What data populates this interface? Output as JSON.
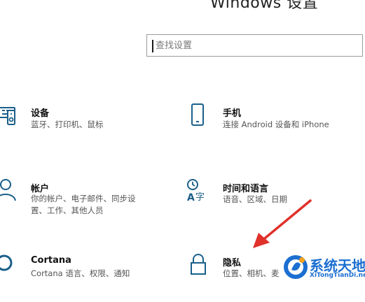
{
  "window": {
    "title": "Windows 设置"
  },
  "search": {
    "placeholder": "查找设置",
    "value": ""
  },
  "tiles": [
    {
      "name": "设备",
      "desc_lines": [
        "蓝牙、打印机、鼠标"
      ],
      "icon": "devices-icon"
    },
    {
      "name": "手机",
      "desc_lines": [
        "连接 Android 设备和 iPhone"
      ],
      "icon": "phone-icon"
    },
    {
      "name": "帐户",
      "desc_lines": [
        "你的帐户、电子邮件、同步设",
        "置、工作、其他人员"
      ],
      "icon": "person-icon"
    },
    {
      "name": "时间和语言",
      "desc_lines": [
        "语音、区域、日期"
      ],
      "icon": "time-language-icon"
    },
    {
      "name": "Cortana",
      "desc_lines": [
        "Cortana 语言、权限、通知"
      ],
      "icon": "cortana-icon"
    },
    {
      "name": "隐私",
      "desc_lines": [
        "位置、相机、麦"
      ],
      "icon": "lock-icon"
    }
  ],
  "annotation": {
    "arrow_color": "#e0312b"
  },
  "watermark": {
    "text_cn": "系统天地",
    "text_en": "XiTongTianDi.net",
    "color": "#1b6fd1"
  },
  "theme": {
    "icon_color": "#1a5f8a",
    "accent": "#0078d7"
  }
}
